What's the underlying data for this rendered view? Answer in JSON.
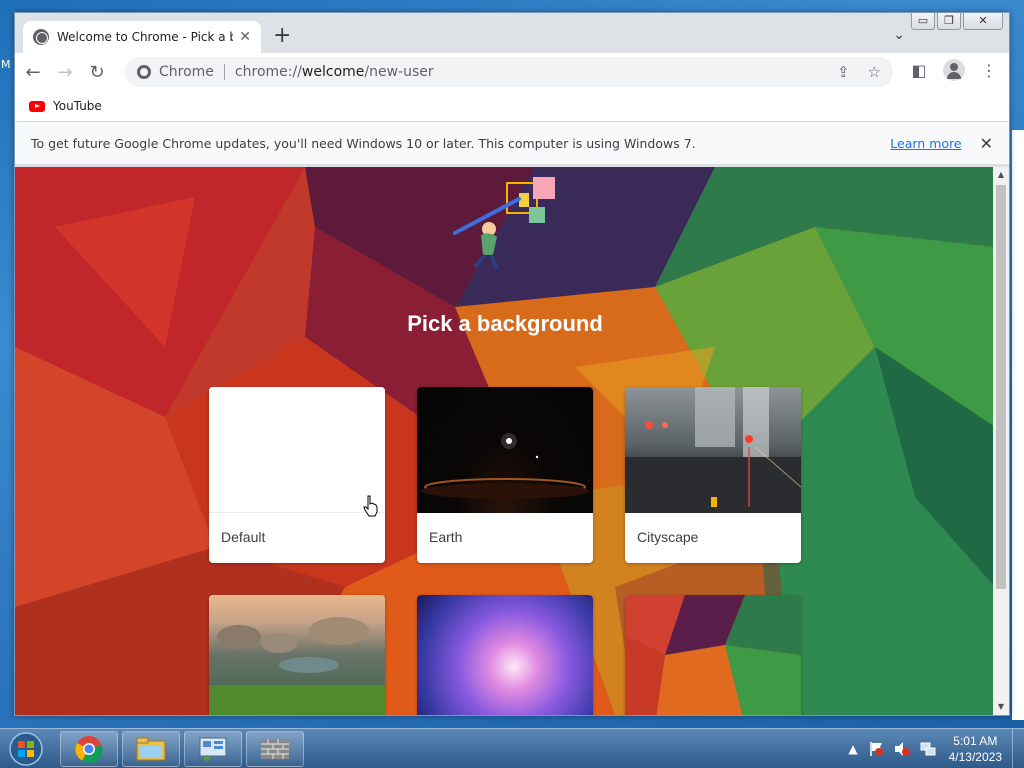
{
  "window": {
    "tab_title": "Welcome to Chrome - Pick a bac",
    "tab_close": "✕",
    "new_tab": "+",
    "tab_dropdown": "⌄",
    "caption": {
      "minimize": "▭",
      "maximize": "❐",
      "close": "✕"
    }
  },
  "toolbar": {
    "back": "←",
    "forward": "→",
    "reload": "↻",
    "omnibox_chip": "Chrome",
    "url_prefix": "chrome://",
    "url_host": "welcome",
    "url_path": "/new-user",
    "share_icon": "⇪",
    "star_icon": "☆",
    "sidepanel_icon": "◧",
    "menu_icon": "⋮"
  },
  "bookmarks": [
    {
      "label": "YouTube"
    }
  ],
  "infobar": {
    "message": "To get future Google Chrome updates, you'll need Windows 10 or later. This computer is using Windows 7.",
    "link": "Learn more",
    "close": "✕"
  },
  "page": {
    "heading": "Pick a background",
    "cards": [
      {
        "label": "Default"
      },
      {
        "label": "Earth"
      },
      {
        "label": "Cityscape"
      },
      {
        "label": ""
      },
      {
        "label": ""
      },
      {
        "label": ""
      }
    ]
  },
  "scrollbar": {
    "up": "▲",
    "down": "▼"
  },
  "taskbar": {
    "time": "5:01 AM",
    "date": "4/13/2023",
    "tray_arrow": "▲"
  },
  "desktop": {
    "left_letter": "M"
  },
  "colors": {
    "accent_link": "#1a73e8",
    "youtube_red": "#ff0000"
  }
}
